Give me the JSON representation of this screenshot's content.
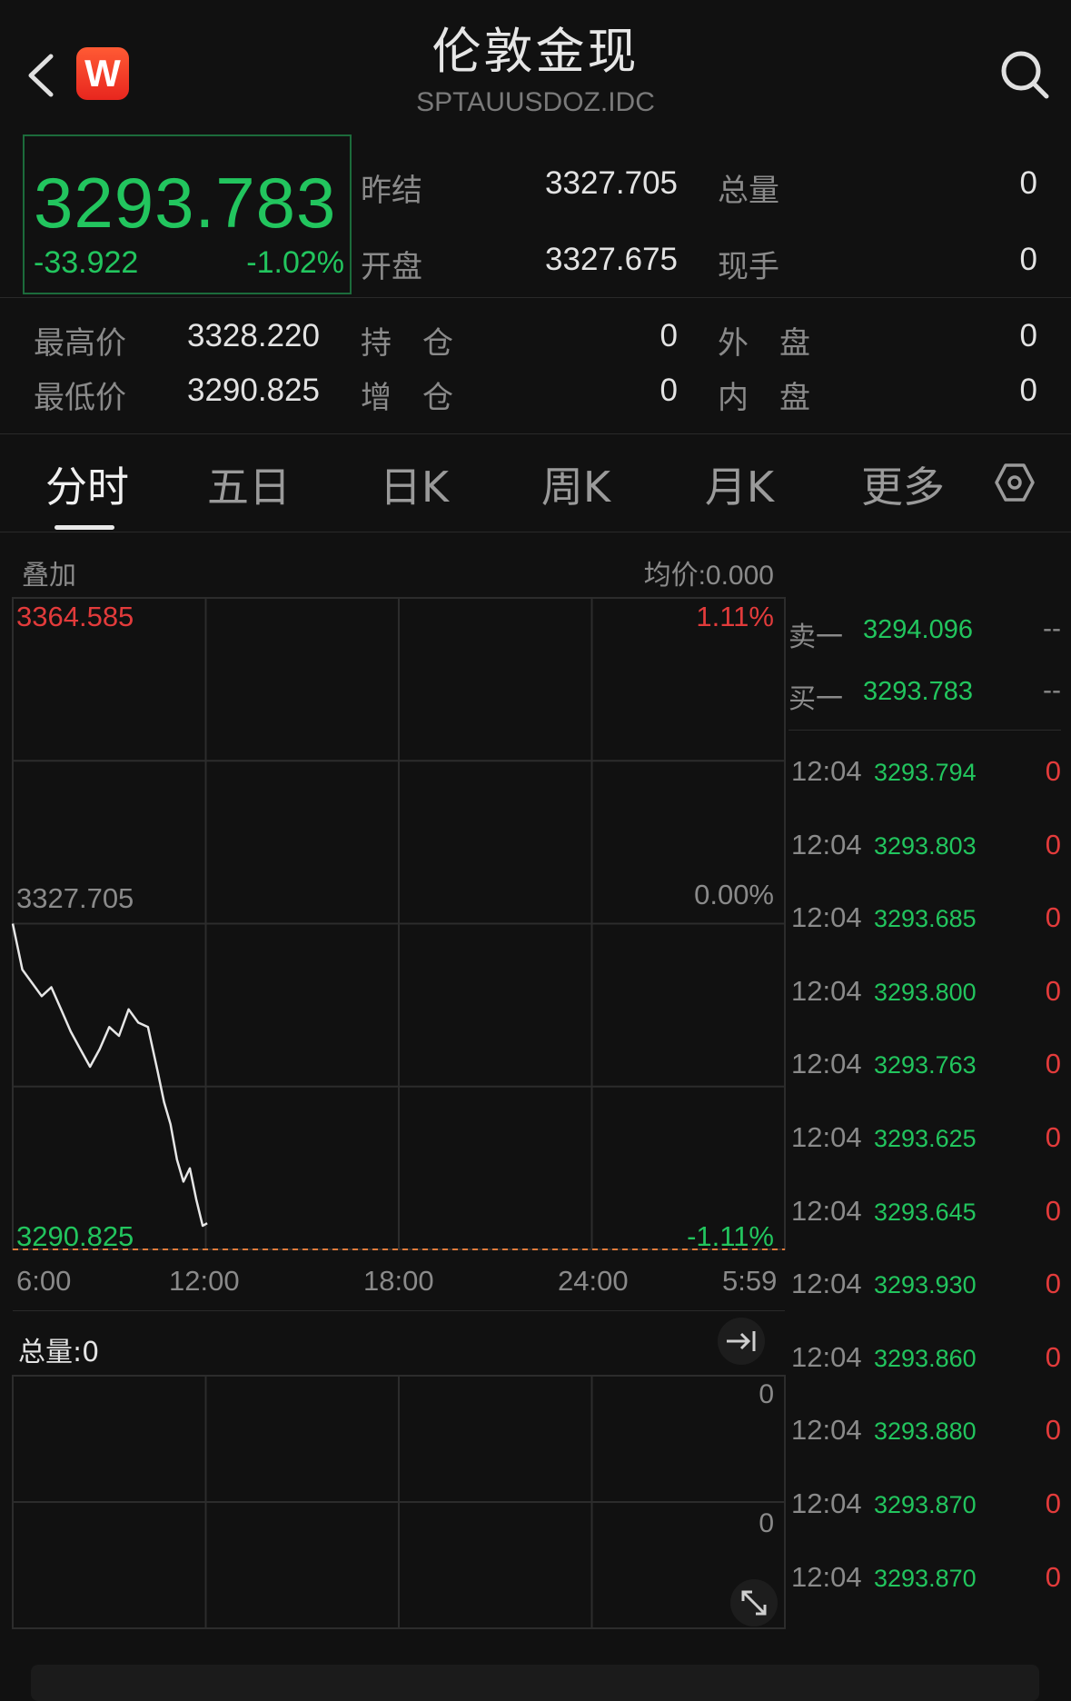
{
  "header": {
    "title": "伦敦金现",
    "subtitle": "SPTAUUSDOZ.IDC",
    "logo_letter": "W"
  },
  "quote": {
    "price": "3293.783",
    "change": "-33.922",
    "change_pct": "-1.02%"
  },
  "stats": {
    "prev_settle_label": "昨结",
    "prev_settle": "3327.705",
    "total_vol_label": "总量",
    "total_vol": "0",
    "open_label": "开盘",
    "open": "3327.675",
    "current_hand_label": "现手",
    "current_hand": "0",
    "high_label": "最高价",
    "high": "3328.220",
    "position_label": "持　仓",
    "position": "0",
    "outer_label": "外　盘",
    "outer": "0",
    "low_label": "最低价",
    "low": "3290.825",
    "increase_label": "增　仓",
    "increase": "0",
    "inner_label": "内　盘",
    "inner": "0"
  },
  "tabs": [
    {
      "label": "分时",
      "active": true
    },
    {
      "label": "五日",
      "active": false
    },
    {
      "label": "日K",
      "active": false
    },
    {
      "label": "周K",
      "active": false
    },
    {
      "label": "月K",
      "active": false
    },
    {
      "label": "更多",
      "active": false
    }
  ],
  "chart_data": {
    "type": "line",
    "overlay_label": "叠加",
    "avg_label": "均价:0.000",
    "y_max_label": "3364.585",
    "y_mid_label": "3327.705",
    "y_min_label": "3290.825",
    "pct_max_label": "1.11%",
    "pct_mid_label": "0.00%",
    "pct_min_label": "-1.11%",
    "ylim": [
      3290.825,
      3364.585
    ],
    "x_ticks": [
      "6:00",
      "12:00",
      "18:00",
      "24:00",
      "5:59"
    ],
    "xlim_hours": [
      6,
      29.98
    ],
    "reference_line": 3290.825,
    "series": [
      {
        "x": [
          6.0,
          6.3,
          6.6,
          6.9,
          7.2,
          7.5,
          7.8,
          8.1,
          8.4,
          8.7,
          9.0,
          9.3,
          9.6,
          9.9,
          10.2,
          10.5,
          10.7,
          10.9,
          11.1,
          11.3,
          11.5,
          11.7,
          11.9,
          12.04
        ],
        "y": [
          3327.7,
          3322.5,
          3321.0,
          3319.5,
          3320.5,
          3318.0,
          3315.5,
          3313.5,
          3311.5,
          3313.5,
          3316.0,
          3315.0,
          3318.0,
          3316.5,
          3316.0,
          3311.0,
          3307.5,
          3305.0,
          3301.0,
          3298.5,
          3300.0,
          3296.5,
          3293.5,
          3293.783
        ]
      }
    ],
    "volume_label": "总量:0",
    "volume_axis_labels": [
      "0",
      "0"
    ]
  },
  "order_book": {
    "ask_label": "卖一",
    "ask_price": "3294.096",
    "ask_vol": "--",
    "bid_label": "买一",
    "bid_price": "3293.783",
    "bid_vol": "--"
  },
  "ticks": [
    {
      "time": "12:04",
      "price": "3293.794",
      "vol": "0"
    },
    {
      "time": "12:04",
      "price": "3293.803",
      "vol": "0"
    },
    {
      "time": "12:04",
      "price": "3293.685",
      "vol": "0"
    },
    {
      "time": "12:04",
      "price": "3293.800",
      "vol": "0"
    },
    {
      "time": "12:04",
      "price": "3293.763",
      "vol": "0"
    },
    {
      "time": "12:04",
      "price": "3293.625",
      "vol": "0"
    },
    {
      "time": "12:04",
      "price": "3293.645",
      "vol": "0"
    },
    {
      "time": "12:04",
      "price": "3293.930",
      "vol": "0"
    },
    {
      "time": "12:04",
      "price": "3293.860",
      "vol": "0"
    },
    {
      "time": "12:04",
      "price": "3293.880",
      "vol": "0"
    },
    {
      "time": "12:04",
      "price": "3293.870",
      "vol": "0"
    },
    {
      "time": "12:04",
      "price": "3293.870",
      "vol": "0"
    }
  ],
  "colors": {
    "up": "#e23b3b",
    "down": "#22c55e",
    "line": "#e6e6e6",
    "grid": "#2c2c2c"
  }
}
